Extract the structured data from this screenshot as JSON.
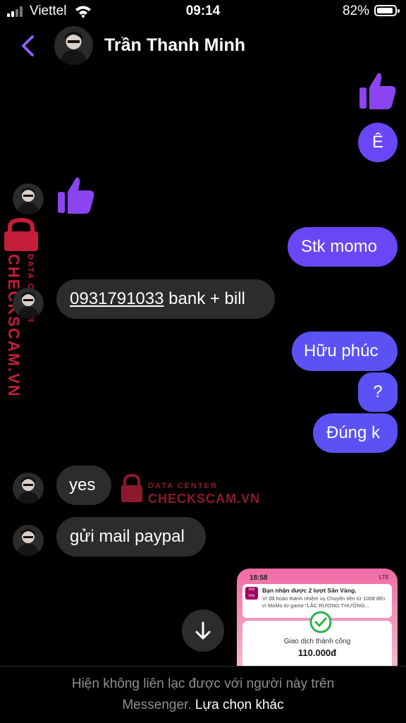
{
  "status_bar": {
    "carrier": "Viettel",
    "time": "09:14",
    "battery": "82%"
  },
  "header": {
    "contact_name": "Trần Thanh Minh"
  },
  "messages": {
    "m_e": "Ê",
    "m_stk": "Stk momo",
    "m_phone": "0931791033",
    "m_bank": " bank + bill",
    "m_huu": "Hữu phúc",
    "m_q": "?",
    "m_dung": "Đúng k",
    "m_yes": "yes",
    "m_mail": "gửi mail paypal"
  },
  "watermark": {
    "top": "DATA CENTER",
    "brand": "CHECKSCAM.VN"
  },
  "preview": {
    "time": "18:58",
    "network": "LTE",
    "logo": "mo mo",
    "notif_title": "Bạn nhận được 2 lượt Săn Vàng.",
    "notif_body": "Vì đã hoàn thành nhiệm vụ Chuyển tiền từ 100đ đến ví MoMo từ game \"LẮC RƯƠNG THƯỞNG...",
    "status": "Giao dịch thành công",
    "amount": "110.000đ"
  },
  "footer": {
    "line1": "Hiện không liên lạc được với người này trên",
    "line2": "Messenger.",
    "link": "Lựa chọn khác"
  },
  "colors": {
    "accent": "#6a47f6",
    "incoming": "#2c2c2e",
    "watermark": "#c41e3a"
  }
}
